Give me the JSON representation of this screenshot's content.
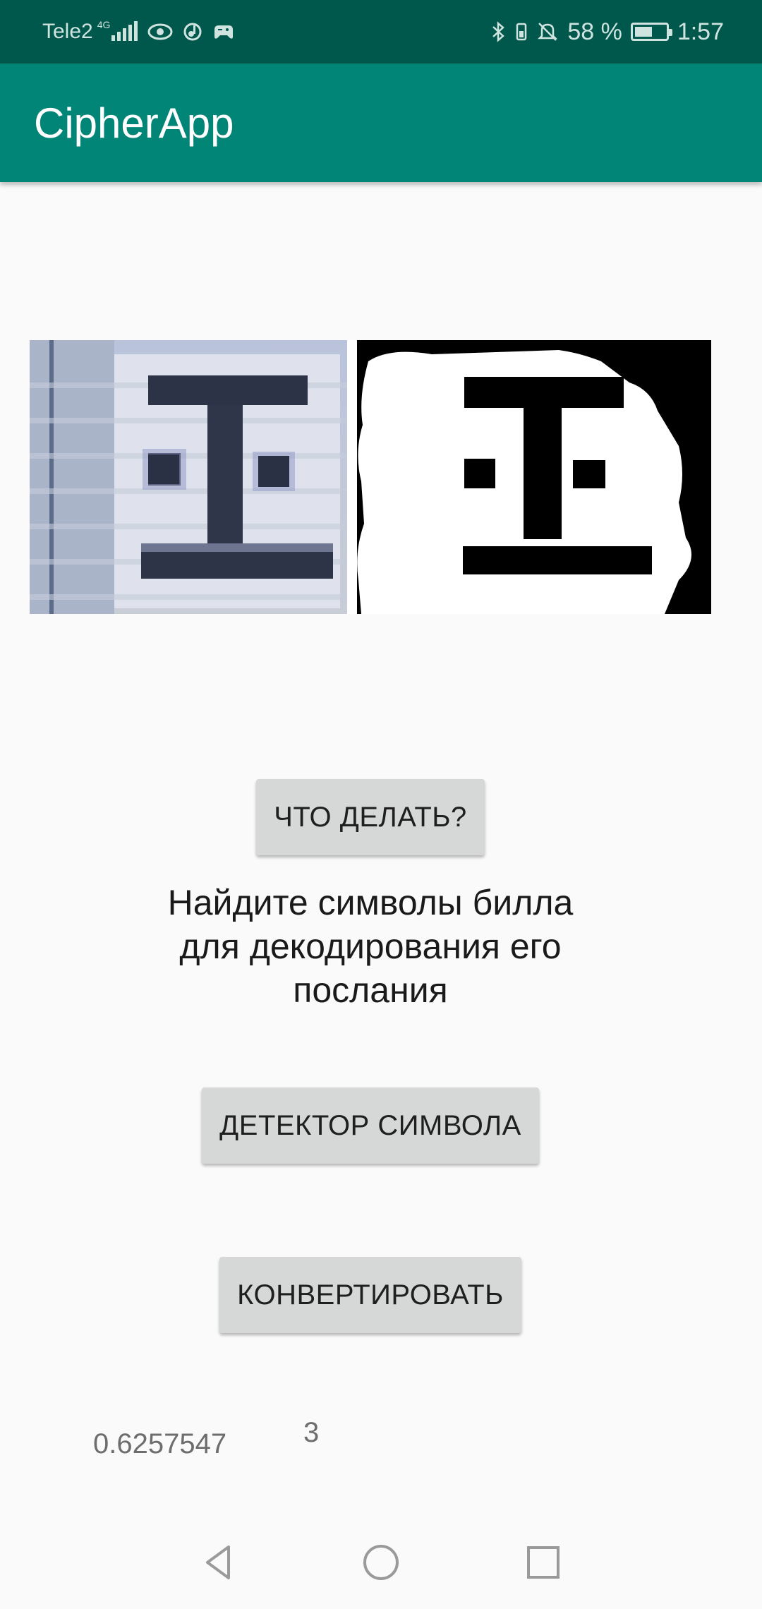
{
  "status_bar": {
    "carrier": "Tele2",
    "network": "4G",
    "battery_text": "58 %",
    "battery_level": 0.58,
    "time": "1:57",
    "icons": [
      "signal-icon",
      "eye-icon",
      "music-icon",
      "game-controller-icon",
      "bluetooth-icon",
      "vibrate-icon",
      "bell-off-icon",
      "battery-charging-icon"
    ]
  },
  "app_bar": {
    "title": "CipherApp"
  },
  "images": {
    "left": "camera-symbol-image",
    "right": "binarized-symbol-image"
  },
  "buttons": {
    "what_to_do": "ЧТО ДЕЛАТЬ?",
    "symbol_detector": "ДЕТЕКТОР СИМВОЛА",
    "convert": "КОНВЕРТИРОВАТЬ"
  },
  "instruction": {
    "line1": "Найдите символы билла",
    "line2": "для декодирования его",
    "line3": "послания"
  },
  "results": {
    "confidence": "0.6257547",
    "symbol": "3"
  },
  "nav_bar": {
    "icons": [
      "back-icon",
      "home-icon",
      "recent-apps-icon"
    ]
  },
  "colors": {
    "status_bar": "#00574b",
    "app_bar": "#008577",
    "button_bg": "#d6d7d7",
    "background": "#fafafa"
  }
}
